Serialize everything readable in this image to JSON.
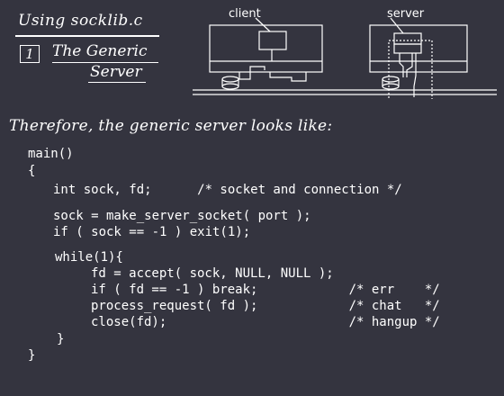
{
  "header": {
    "title": "Using socklib.c",
    "section_number": "1",
    "section_title_line1": "The Generic",
    "section_title_line2": "Server"
  },
  "diagram": {
    "client_label": "client",
    "server_label": "server"
  },
  "intro": "Therefore, the generic server looks like:",
  "code": [
    "main()",
    "{",
    "int sock, fd;      /* socket and connection */",
    "sock = make_server_socket( port );",
    "if ( sock == -1 ) exit(1);",
    "while(1){",
    "fd = accept( sock, NULL, NULL );",
    "if ( fd == -1 ) break;            /* err    */",
    "process_request( fd );            /* chat   */",
    "close(fd);                        /* hangup */",
    "}",
    "}"
  ]
}
